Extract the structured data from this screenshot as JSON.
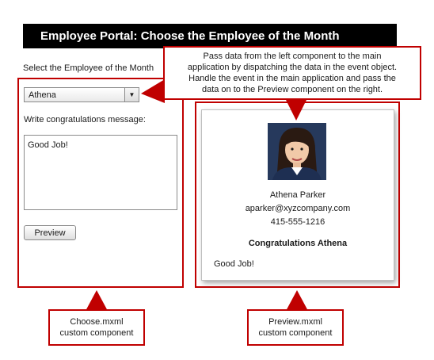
{
  "portal": {
    "title": "Employee Portal: Choose the Employee of the Month"
  },
  "choose": {
    "select_label": "Select the Employee of the Month",
    "dropdown_value": "Athena",
    "message_label": "Write congratulations message:",
    "message_value": "Good Job!",
    "preview_button": "Preview"
  },
  "preview": {
    "name": "Athena Parker",
    "email": "aparker@xyzcompany.com",
    "phone": "415-555-1216",
    "congrats": "Congratulations Athena",
    "message": "Good Job!"
  },
  "callout": {
    "lines": [
      "Pass data from the left component to the main",
      "application by dispatching the data in the event object.",
      "Handle the event in the main application and pass the",
      "data on to the Preview component on the right."
    ]
  },
  "labels": {
    "choose_component": [
      "Choose.mxml",
      "custom component"
    ],
    "preview_component": [
      "Preview.mxml",
      "custom component"
    ]
  },
  "colors": {
    "accent_red": "#c00000",
    "title_bg": "#000000"
  }
}
